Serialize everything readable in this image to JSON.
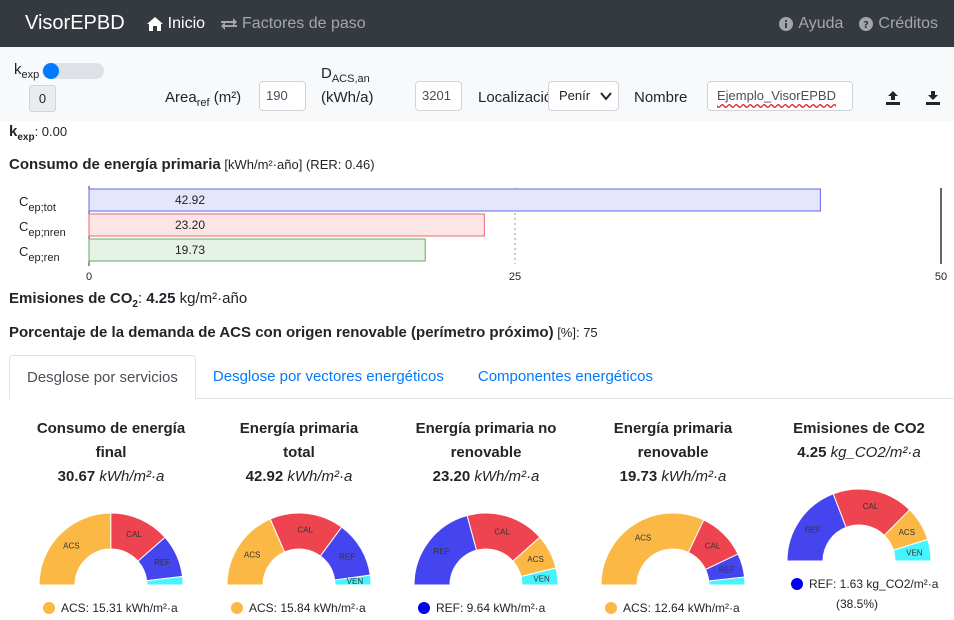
{
  "navbar": {
    "brand": "VisorEPBD",
    "inicio": "Inicio",
    "factores": "Factores de paso",
    "ayuda": "Ayuda",
    "creditos": "Créditos"
  },
  "controls": {
    "kexp_label": "k",
    "kexp_sub": "exp",
    "kexp_value": "0",
    "area_label": "Area",
    "area_sub": "ref",
    "area_unit": " (m²)",
    "area_value": "190",
    "dacs_label": "D",
    "dacs_sub": "ACS,an",
    "dacs_unit": "(kWh/a)",
    "dacs_value": "3201",
    "localizacion_label": "Localización",
    "localizacion_value": "Penír",
    "nombre_label": "Nombre",
    "nombre_value": "Ejemplo_VisorEPBD"
  },
  "summary": {
    "kexp_label": "k",
    "kexp_sub": "exp",
    "kexp_text": ": 0.00",
    "consumo_title": "Consumo de energía primaria",
    "consumo_units": " [kWh/m²·año] (RER: 0.46)",
    "emisiones_label": "Emisiones de CO",
    "emisiones_sub": "2",
    "emisiones_sep": ": ",
    "emisiones_value": "4.25",
    "emisiones_units": " kg/m²·año",
    "acs_title": "Porcentaje de la demanda de ACS con origen renovable (perímetro próximo)",
    "acs_units": " [%]: 75"
  },
  "bar_chart": {
    "labels": [
      {
        "main": "C",
        "sub": "ep;tot"
      },
      {
        "main": "C",
        "sub": "ep;nren"
      },
      {
        "main": "C",
        "sub": "ep;ren"
      }
    ],
    "values": [
      42.92,
      23.2,
      19.73
    ],
    "value_labels": [
      "42.92",
      "23.20",
      "19.73"
    ],
    "fills": [
      "#e5e5fc",
      "#fde5e6",
      "#e5f2e5"
    ],
    "strokes": [
      "#6666ee",
      "#ee6670",
      "#66aa66"
    ],
    "xlim": [
      0,
      50
    ],
    "ticks": [
      "0",
      "25",
      "50"
    ],
    "tick_values": [
      0,
      25,
      50
    ]
  },
  "tabs": [
    {
      "label": "Desglose por servicios"
    },
    {
      "label": "Desglose por vectores energéticos"
    },
    {
      "label": "Componentes energéticos"
    }
  ],
  "colors": {
    "CAL": "#ee4450",
    "ACS": "#fbb845",
    "REF": "#4545f0",
    "VEN": "#45f4ff"
  },
  "gauges": [
    {
      "title1": "Consumo de energía",
      "title2": "final",
      "value": "30.67",
      "units": "kWh/m²·a",
      "segments": [
        {
          "name": "ACS",
          "v": 15.31
        },
        {
          "name": "CAL",
          "v": 8.3
        },
        {
          "name": "REF",
          "v": 5.9
        },
        {
          "name": "VEN",
          "v": 1.16
        }
      ],
      "legend": "ACS: 15.31 kWh/m²·a",
      "legend_color": "#fbb845"
    },
    {
      "title1": "Energía primaria",
      "title2": "total",
      "value": "42.92",
      "units": "kWh/m²·a",
      "segments": [
        {
          "name": "ACS",
          "v": 15.84
        },
        {
          "name": "CAL",
          "v": 14.3
        },
        {
          "name": "REF",
          "v": 10.9
        },
        {
          "name": "VEN",
          "v": 1.88
        }
      ],
      "legend": "ACS: 15.84 kWh/m²·a",
      "legend_color": "#fbb845"
    },
    {
      "title1": "Energía primaria no",
      "title2": "renovable",
      "value": "23.20",
      "units": "kWh/m²·a",
      "segments": [
        {
          "name": "REF",
          "v": 9.64
        },
        {
          "name": "CAL",
          "v": 8.2
        },
        {
          "name": "ACS",
          "v": 3.6
        },
        {
          "name": "VEN",
          "v": 1.76
        }
      ],
      "legend": "REF: 9.64 kWh/m²·a",
      "legend_color": "#0000ee"
    },
    {
      "title1": "Energía primaria",
      "title2": "renovable",
      "value": "19.73",
      "units": "kWh/m²·a",
      "segments": [
        {
          "name": "ACS",
          "v": 12.64
        },
        {
          "name": "CAL",
          "v": 4.3
        },
        {
          "name": "REF",
          "v": 2.1
        },
        {
          "name": "VEN",
          "v": 0.69
        }
      ],
      "legend": "ACS: 12.64 kWh/m²·a",
      "legend_color": "#fbb845"
    },
    {
      "title1": "Emisiones de CO2",
      "title2": "",
      "value": "4.25",
      "units": "kg_CO2/m²·a",
      "segments": [
        {
          "name": "REF",
          "v": 1.63
        },
        {
          "name": "CAL",
          "v": 1.55
        },
        {
          "name": "ACS",
          "v": 0.66
        },
        {
          "name": "VEN",
          "v": 0.41
        }
      ],
      "legend": "REF: 1.63 kg_CO2/m²·a",
      "legend_color": "#0000ee",
      "legend_pct": "(38.5%)"
    }
  ]
}
